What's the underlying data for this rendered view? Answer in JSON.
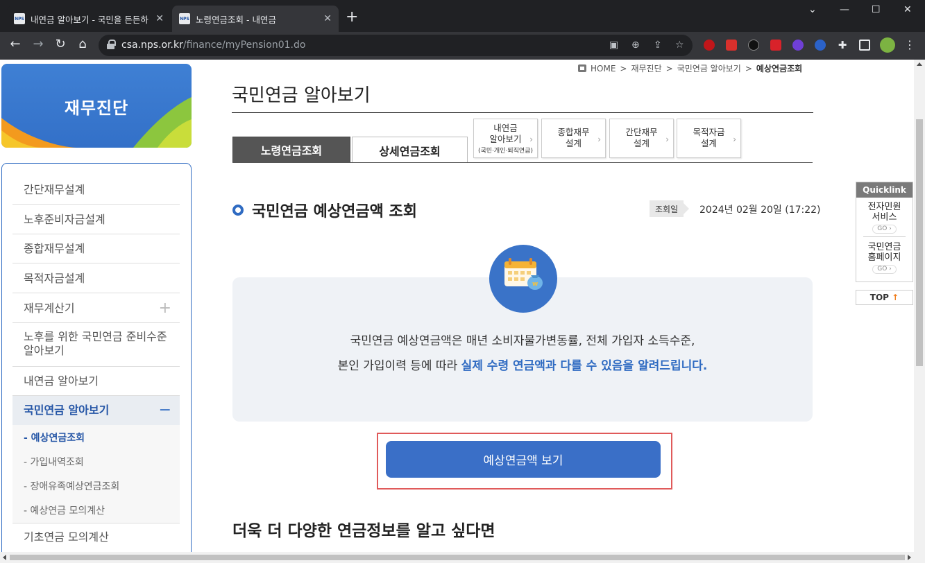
{
  "browser": {
    "tabs": [
      {
        "title": "내연금 알아보기 - 국민을 든든하",
        "favicon": "NPS",
        "active": false
      },
      {
        "title": "노령연금조회 - 내연금",
        "favicon": "NPS",
        "active": true
      }
    ],
    "new_tab": "+",
    "url_host": "csa.nps.or.kr",
    "url_path": "/finance/myPension01.do",
    "window_controls": [
      "⌄",
      "—",
      "☐",
      "✕"
    ]
  },
  "sidebar": {
    "banner_title": "재무진단",
    "items": [
      {
        "label": "간단재무설계"
      },
      {
        "label": "노후준비자금설계"
      },
      {
        "label": "종합재무설계"
      },
      {
        "label": "목적자금설계"
      },
      {
        "label": "재무계산기",
        "toggle": "+"
      },
      {
        "label": "노후를 위한 국민연금 준비수준 알아보기"
      },
      {
        "label": "내연금 알아보기"
      },
      {
        "label": "국민연금 알아보기",
        "toggle": "−"
      },
      {
        "label": "기초연금 모의계산"
      }
    ],
    "subitems": [
      {
        "label": "- 예상연금조회"
      },
      {
        "label": "- 가입내역조회"
      },
      {
        "label": "- 장애유족예상연금조회"
      },
      {
        "label": "- 예상연금 모의계산"
      }
    ]
  },
  "breadcrumb": {
    "items": [
      "HOME",
      "재무진단",
      "국민연금 알아보기",
      "예상연금조회"
    ],
    "separator": ">"
  },
  "page": {
    "title": "국민연금 알아보기",
    "tabs": [
      "노령연금조회",
      "상세연금조회"
    ],
    "shortcut_tabs": [
      {
        "line1": "내연금",
        "line2": "알아보기",
        "note": "(국민·개인·퇴직연금)"
      },
      {
        "line1": "종합재무",
        "line2": "설계"
      },
      {
        "line1": "간단재무",
        "line2": "설계"
      },
      {
        "line1": "목적자금",
        "line2": "설계"
      }
    ],
    "section_title": "국민연금 예상연금액 조회",
    "date_label": "조회일",
    "date_value": "2024년 02월 20일 (17:22)",
    "info_line1": "국민연금 예상연금액은 매년 소비자물가변동률, 전체 가입자 소득수준,",
    "info_line2_a": "본인 가입이력 등에 따라 ",
    "info_line2_b": "실제 수령 연금액과 다를 수 있음을 알려드립니다.",
    "main_button": "예상연금액 보기",
    "more_heading": "더욱 더 다양한 연금정보를 알고 싶다면"
  },
  "quicklink": {
    "header": "Quicklink",
    "items": [
      {
        "line1": "전자민원",
        "line2": "서비스",
        "go": "GO ›"
      },
      {
        "line1": "국민연금",
        "line2": "홈페이지",
        "go": "GO ›"
      }
    ],
    "top": "TOP",
    "top_arrow": "↑"
  },
  "colors": {
    "accent": "#2f6bc2",
    "button": "#3a6fc7",
    "highlight_border": "#e05a5a"
  }
}
